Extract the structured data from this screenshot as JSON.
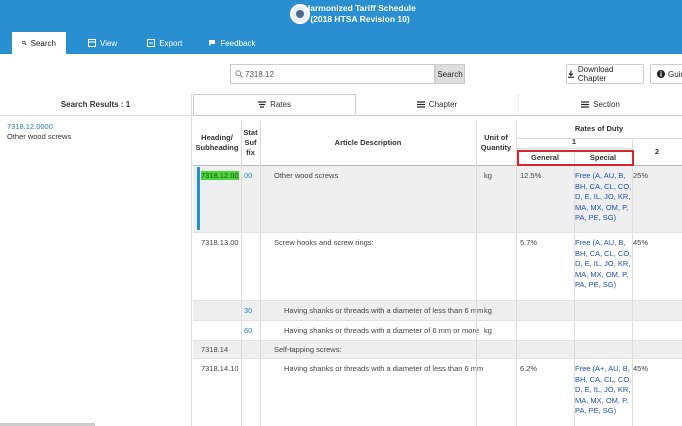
{
  "app": {
    "title_line1": "Harmonized Tariff Schedule",
    "title_line2": "(2018 HTSA Revision 10)"
  },
  "nav": [
    {
      "label": "Search",
      "icon": "search-icon"
    },
    {
      "label": "View",
      "icon": "view-icon"
    },
    {
      "label": "Export",
      "icon": "export-icon"
    },
    {
      "label": "Feedback",
      "icon": "feedback-icon"
    }
  ],
  "search": {
    "value": "7318.12",
    "button": "Search"
  },
  "toolbar": {
    "download_label": "Download Chapter",
    "guide_label": "Guid"
  },
  "results": {
    "title": "Search Results : 1",
    "items": [
      {
        "code": "7318.12.0000",
        "desc": "Other wood screws"
      }
    ]
  },
  "tabs": [
    {
      "label": "Rates"
    },
    {
      "label": "Chapter"
    },
    {
      "label": "Section"
    }
  ],
  "table": {
    "headers": {
      "heading": "Heading/ Subheading",
      "stat": "Stat Suf fix",
      "desc": "Article Description",
      "unit": "Unit of Quantity",
      "rates": "Rates of Duty",
      "col1": "1",
      "general": "General",
      "special": "Special",
      "col2": "2"
    },
    "rows": [
      {
        "heading": "7318.12.00",
        "stat": "00",
        "desc": "Other wood screws",
        "unit": "kg",
        "general": "12.5%",
        "special": "Free (A, AU, B, BH, CA, CL, CO, D, E, IL, JO, KR, MA, MX, OM, P, PA, PE, SG)",
        "col2": "25%"
      },
      {
        "heading": "7318.13.00",
        "stat": "",
        "desc": "Screw hooks and screw rings:",
        "unit": "",
        "general": "5.7%",
        "special": "Free (A, AU, B, BH, CA, CL, CO, D, E, IL, JO, KR, MA, MX, OM, P, PA, PE, SG)",
        "col2": "45%"
      },
      {
        "heading": "",
        "stat": "30",
        "desc": "Having shanks or threads with a diameter of less than 6 mm",
        "unit": "kg",
        "general": "",
        "special": "",
        "col2": ""
      },
      {
        "heading": "",
        "stat": "60",
        "desc": "Having shanks or threads with a diameter of 6 mm or more",
        "unit": "kg",
        "general": "",
        "special": "",
        "col2": ""
      },
      {
        "heading": "7318.14",
        "stat": "",
        "desc": "Self-tapping screws:",
        "unit": "",
        "general": "",
        "special": "",
        "col2": ""
      },
      {
        "heading": "7318.14.10",
        "stat": "",
        "desc": "Having shanks or threads with a diameter of less than 6 mm",
        "unit": "",
        "general": "6.2%",
        "special": "Free (A+, AU, B, BH, CA, CL, CO, D, E, IL, JO, KR, MA, MX, OM, P, PA, PE, SG)",
        "col2": "45%"
      }
    ]
  },
  "colors": {
    "brand": "#2a8fd0",
    "highlight": "#4cd43c",
    "annotation": "#d9232d"
  }
}
